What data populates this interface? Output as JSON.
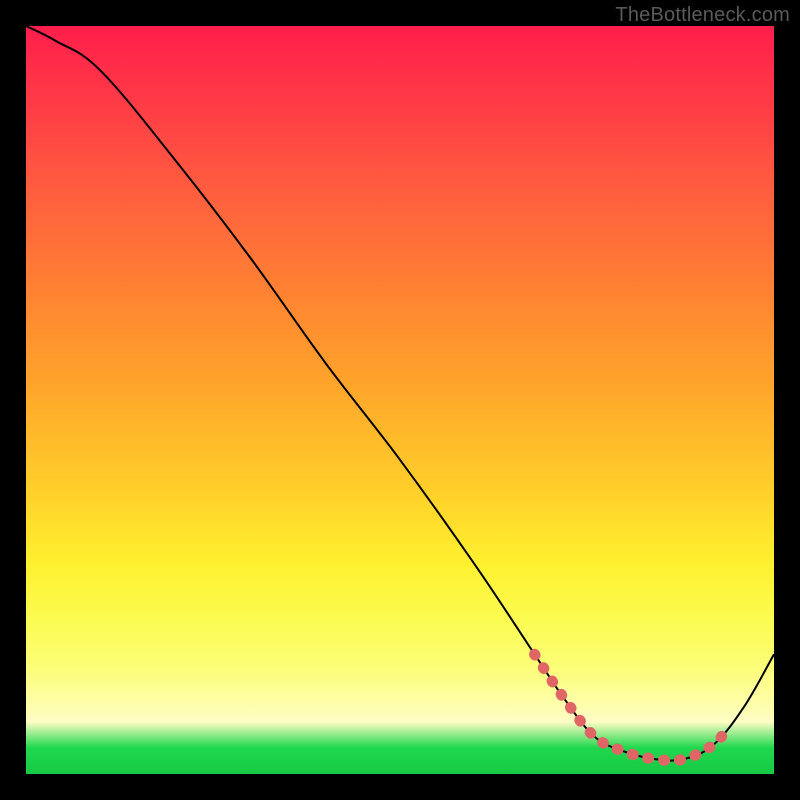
{
  "watermark": "TheBottleneck.com",
  "chart_data": {
    "type": "line",
    "title": "",
    "xlabel": "",
    "ylabel": "",
    "xlim": [
      0,
      100
    ],
    "ylim": [
      0,
      100
    ],
    "grid": false,
    "legend": false,
    "series": [
      {
        "name": "curve",
        "x": [
          0,
          4,
          10,
          20,
          30,
          40,
          50,
          60,
          68,
          72,
          76,
          80,
          84,
          88,
          92,
          96,
          100
        ],
        "values": [
          100,
          98,
          94,
          82,
          69,
          55,
          42,
          28,
          16,
          10,
          5,
          3,
          2,
          2,
          4,
          9,
          16
        ]
      }
    ],
    "highlight_range_x": [
      68,
      94
    ],
    "colors": {
      "curve": "#000000",
      "highlight": "#e06666",
      "gradient_top": "#ff1e4c",
      "gradient_bottom": "#17c944"
    }
  }
}
